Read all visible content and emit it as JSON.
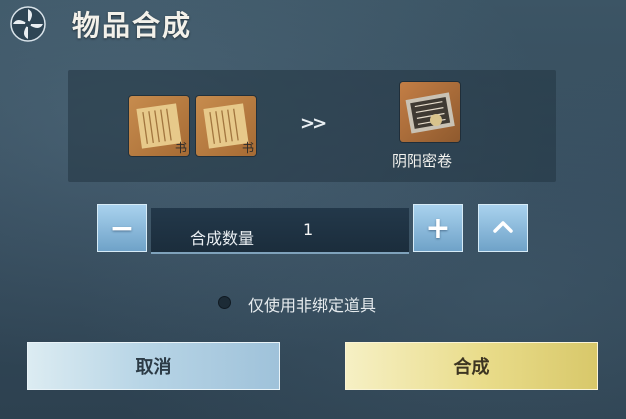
{
  "window": {
    "title": "物品合成"
  },
  "recipe": {
    "materials": [
      {
        "icon": "scroll-manual-icon",
        "count": ""
      },
      {
        "icon": "scroll-manual-icon",
        "count": ""
      }
    ],
    "arrow_icon": "double-chevron-right-icon",
    "output": {
      "icon": "yin-yang-secret-scroll-icon",
      "name": "阴阳密卷"
    }
  },
  "quantity": {
    "label": "合成数量",
    "value": "1",
    "decrease_label": "−",
    "increase_label": "+",
    "max_icon": "chevron-up-icon"
  },
  "options": {
    "bound_only_label": "仅使用非绑定道具",
    "bound_only_checked": false
  },
  "actions": {
    "cancel_label": "取消",
    "confirm_label": "合成"
  },
  "colors": {
    "cancel_button": "#b8d5e6",
    "confirm_button": "#e9dc8a",
    "background": "#33495a"
  }
}
